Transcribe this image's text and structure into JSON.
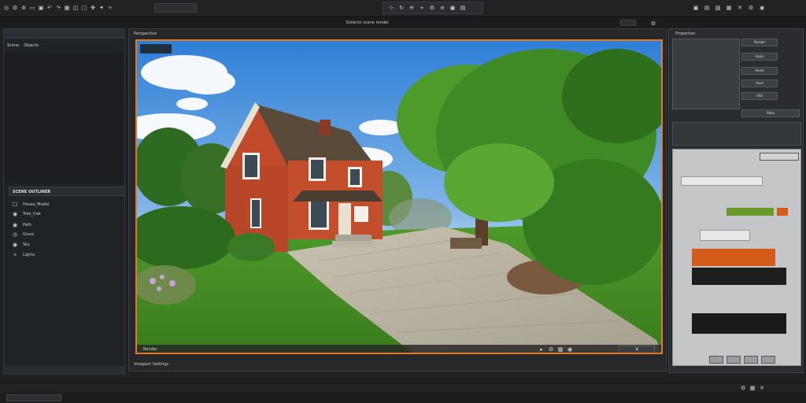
{
  "app": {
    "viewport_title": "Exterior scene render",
    "toolbar_field": "",
    "left_header": "",
    "left_tabs": [
      "Scene",
      "Objects"
    ],
    "outliner_title": "SCENE OUTLINER",
    "outliner_items": [
      "House_Model",
      "Tree_Oak",
      "Path",
      "Grass",
      "Sky",
      "Lights"
    ],
    "view_label": "Perspective",
    "status_left": "",
    "render_size": "Render",
    "nav_label": "",
    "right_header": "Properties",
    "right_buttons": [
      "Render",
      "Apply",
      "Reset",
      "Save",
      "Add",
      "Bake"
    ],
    "color_accent": "#e07a2a",
    "swatch_green": "#6a9a2a",
    "swatch_orange": "#d45a1a",
    "bottom_label": "Viewport Settings"
  },
  "icons": [
    "globe-icon",
    "gear-icon",
    "folder-icon",
    "save-icon",
    "undo-icon",
    "redo-icon",
    "grid-icon",
    "camera-icon",
    "settings-icon",
    "close-icon"
  ]
}
